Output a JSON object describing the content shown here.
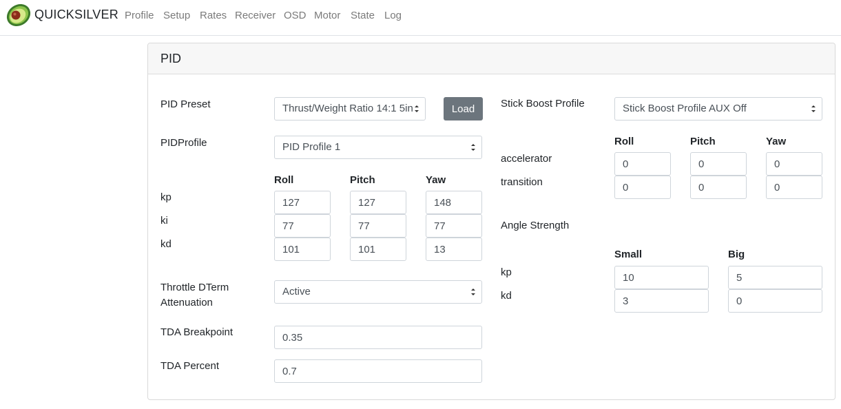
{
  "nav": {
    "brand": "QUICKSILVER",
    "logo_icon": "avocado-logo-icon",
    "links": [
      "Profile",
      "Setup",
      "Rates",
      "Receiver",
      "OSD",
      "Motor",
      "State",
      "Log"
    ]
  },
  "card": {
    "title": "PID"
  },
  "left": {
    "preset": {
      "label": "PID Preset",
      "value": "Thrust/Weight Ratio 14:1 5in",
      "load_label": "Load"
    },
    "profile": {
      "label": "PIDProfile",
      "value": "PID Profile 1"
    },
    "pid": {
      "columns": [
        "Roll",
        "Pitch",
        "Yaw"
      ],
      "rows": [
        {
          "label": "kp",
          "values": [
            "127",
            "127",
            "148"
          ]
        },
        {
          "label": "ki",
          "values": [
            "77",
            "77",
            "77"
          ]
        },
        {
          "label": "kd",
          "values": [
            "101",
            "101",
            "13"
          ]
        }
      ]
    },
    "tda": {
      "label_line1": "Throttle DTerm",
      "label_line2": "Attenuation",
      "value": "Active"
    },
    "tda_breakpoint": {
      "label": "TDA Breakpoint",
      "value": "0.35"
    },
    "tda_percent": {
      "label": "TDA Percent",
      "value": "0.7"
    }
  },
  "right": {
    "stick_boost": {
      "label": "Stick Boost Profile",
      "value": "Stick Boost Profile AUX Off"
    },
    "boost": {
      "columns": [
        "Roll",
        "Pitch",
        "Yaw"
      ],
      "rows": [
        {
          "label": "accelerator",
          "values": [
            "0",
            "0",
            "0"
          ]
        },
        {
          "label": "transition",
          "values": [
            "0",
            "0",
            "0"
          ]
        }
      ]
    },
    "angle": {
      "label": "Angle Strength",
      "columns": [
        "Small",
        "Big"
      ],
      "rows": [
        {
          "label": "kp",
          "values": [
            "10",
            "5"
          ]
        },
        {
          "label": "kd",
          "values": [
            "3",
            "0"
          ]
        }
      ]
    }
  },
  "colors": {
    "accent_button": "#6c757d",
    "nav_text": "#7a7a7a",
    "header_bg": "#f7f7f7"
  }
}
